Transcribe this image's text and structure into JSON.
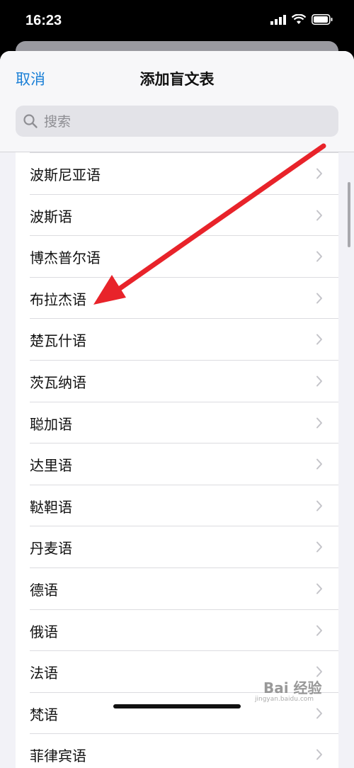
{
  "status_bar": {
    "time": "16:23"
  },
  "header": {
    "cancel_label": "取消",
    "title": "添加盲文表"
  },
  "search": {
    "placeholder": "搜索"
  },
  "languages": [
    {
      "label": "波斯尼亚语"
    },
    {
      "label": "波斯语"
    },
    {
      "label": "博杰普尔语"
    },
    {
      "label": "布拉杰语"
    },
    {
      "label": "楚瓦什语"
    },
    {
      "label": "茨瓦纳语"
    },
    {
      "label": "聪加语"
    },
    {
      "label": "达里语"
    },
    {
      "label": "鞑靼语"
    },
    {
      "label": "丹麦语"
    },
    {
      "label": "德语"
    },
    {
      "label": "俄语"
    },
    {
      "label": "法语"
    },
    {
      "label": "梵语"
    },
    {
      "label": "菲律宾语"
    }
  ],
  "watermark": {
    "text": "Bai 经验",
    "sub": "jingyan.baidu.com"
  },
  "colors": {
    "accent": "#1a7fd6",
    "arrow": "#e8232a"
  }
}
